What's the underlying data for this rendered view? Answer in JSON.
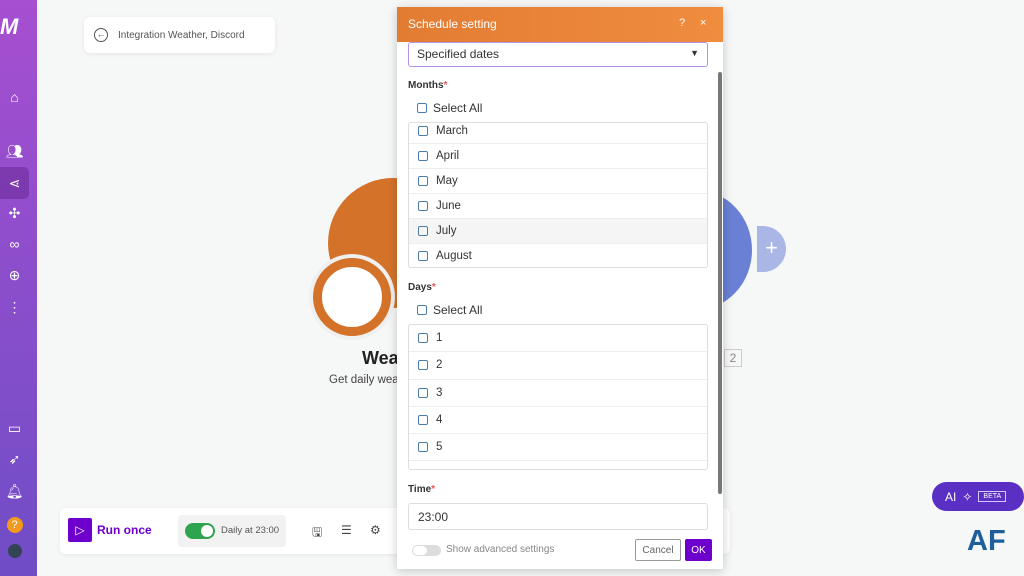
{
  "breadcrumb": {
    "title": "Integration Weather, Discord"
  },
  "canvas": {
    "module_title": "Wea",
    "module_subtitle": "Get daily wea",
    "discord_badge": "2",
    "colors": {
      "weather": "#d4722a",
      "discord": "#6a80d4"
    }
  },
  "toolbar": {
    "run_once": "Run once",
    "schedule": "Daily at 23:00",
    "schedule_enabled": true
  },
  "ai_button": {
    "label": "AI",
    "badge": "BETA"
  },
  "watermark": "AF",
  "dialog": {
    "title": "Schedule setting",
    "help": "?",
    "close": "×",
    "schedule_type": "Specified dates",
    "months_label": "Months",
    "months_select_all": "Select All",
    "months": [
      "March",
      "April",
      "May",
      "June",
      "July",
      "August"
    ],
    "days_label": "Days",
    "days_select_all": "Select All",
    "days": [
      "1",
      "2",
      "3",
      "4",
      "5"
    ],
    "time_label": "Time",
    "time_value": "23:00",
    "advanced": "Show advanced settings",
    "cancel": "Cancel",
    "ok": "OK",
    "required_mark": "*"
  }
}
